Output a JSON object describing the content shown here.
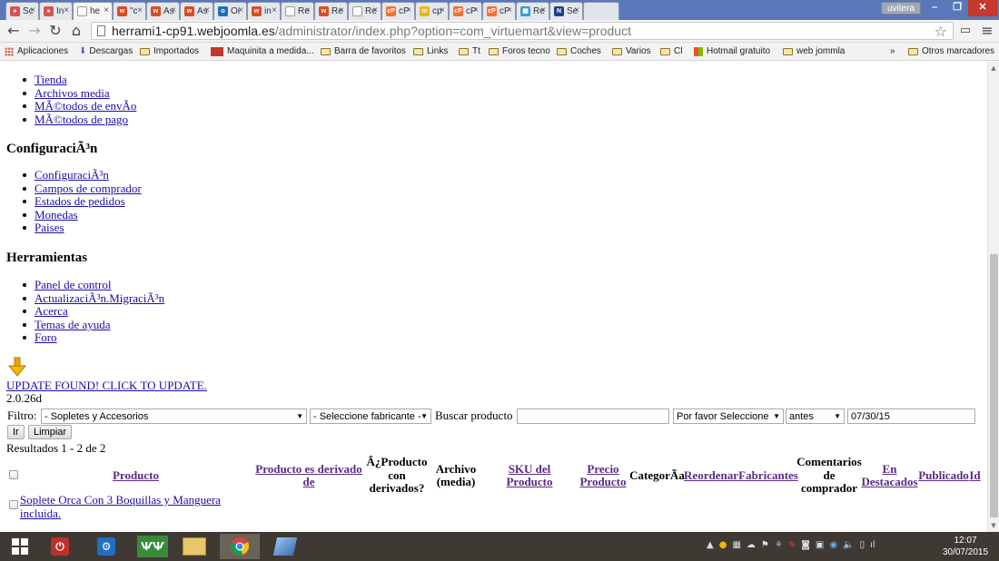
{
  "browser": {
    "tabs": [
      {
        "label": "Sc",
        "favicon_color": "#d9534f",
        "favicon_glyph": "●"
      },
      {
        "label": "In",
        "favicon_color": "#d9534f",
        "favicon_glyph": "●"
      },
      {
        "label": "he",
        "favicon_color": "#ffffff",
        "favicon_glyph": "",
        "active": true
      },
      {
        "label": "\"c",
        "favicon_color": "#e04a1f",
        "favicon_glyph": "w"
      },
      {
        "label": "As",
        "favicon_color": "#e04a1f",
        "favicon_glyph": "w"
      },
      {
        "label": "As",
        "favicon_color": "#e04a1f",
        "favicon_glyph": "w"
      },
      {
        "label": "Oi",
        "favicon_color": "#1e6fbf",
        "favicon_glyph": "o"
      },
      {
        "label": "in",
        "favicon_color": "#e04a1f",
        "favicon_glyph": "w"
      },
      {
        "label": "Re",
        "favicon_color": "#ffffff",
        "favicon_glyph": ""
      },
      {
        "label": "Re",
        "favicon_color": "#e04a1f",
        "favicon_glyph": "w"
      },
      {
        "label": "Re",
        "favicon_color": "#ffffff",
        "favicon_glyph": ""
      },
      {
        "label": "cP",
        "favicon_color": "#ff6c2c",
        "favicon_glyph": "cP"
      },
      {
        "label": "cp",
        "favicon_color": "#f0b400",
        "favicon_glyph": "m"
      },
      {
        "label": "cP",
        "favicon_color": "#ff6c2c",
        "favicon_glyph": "cP"
      },
      {
        "label": "cP",
        "favicon_color": "#ff6c2c",
        "favicon_glyph": "cP"
      },
      {
        "label": "Re",
        "favicon_color": "#3a9ad9",
        "favicon_glyph": "▦"
      },
      {
        "label": "Se",
        "favicon_color": "#1e3f8a",
        "favicon_glyph": "N"
      }
    ],
    "user_badge": "uvitera",
    "window_buttons": [
      "–",
      "❐",
      "✕"
    ],
    "url_host": "herrami1-cp91.webjoomla.es",
    "url_path": "/administrator/index.php?option=com_virtuemart&view=product",
    "bookmarks": [
      {
        "label": "Aplicaciones",
        "icon": "apps-grid-icon"
      },
      {
        "label": "Descargas",
        "icon": "download-icon"
      },
      {
        "label": "Importados",
        "icon": "folder-icon"
      },
      {
        "label": "Maquinita a medida...",
        "icon": "maquinita-icon"
      },
      {
        "label": "Barra de favoritos",
        "icon": "folder-icon"
      },
      {
        "label": "Links",
        "icon": "folder-icon"
      },
      {
        "label": "Tt",
        "icon": "folder-icon"
      },
      {
        "label": "Foros tecno",
        "icon": "folder-icon"
      },
      {
        "label": "Coches",
        "icon": "folder-icon"
      },
      {
        "label": "Varios",
        "icon": "folder-icon"
      },
      {
        "label": "Cl",
        "icon": "folder-icon"
      },
      {
        "label": "Hotmail gratuito",
        "icon": "hotmail-icon"
      },
      {
        "label": "web jommla",
        "icon": "folder-icon"
      }
    ],
    "bookmarks_overflow": "»",
    "other_bookmarks": "Otros marcadores"
  },
  "page": {
    "menu_top": [
      "Tienda",
      "Archivos media",
      "MÃ©todos de envÃo",
      "MÃ©todos de pago"
    ],
    "section_config": "ConfiguraciÃ³n",
    "menu_config": [
      "ConfiguraciÃ³n",
      "Campos de comprador",
      "Estados de pedidos",
      "Monedas",
      "Paises"
    ],
    "section_tools": "Herramientas",
    "menu_tools": [
      "Panel de control",
      "ActualizaciÃ³n.MigraciÃ³n",
      "Acerca",
      "Temas de ayuda",
      "Foro"
    ],
    "update_link": "UPDATE FOUND! CLICK TO UPDATE.",
    "version": "2.0.26d",
    "filter": {
      "label": "Filtro:",
      "category_value": "- Sopletes y Accesorios",
      "manufacturer_value": "- Seleccione fabricante -",
      "search_label": "Buscar producto",
      "search_value": "",
      "date_type_value": "Por favor Seleccione",
      "date_op_value": "antes",
      "date_value": "07/30/15",
      "go_label": "Ir",
      "clear_label": "Limpiar"
    },
    "results_text": "Resultados 1 - 2 de 2",
    "columns": [
      {
        "label": "Producto",
        "link": true
      },
      {
        "label": "Producto es derivado de",
        "link": true
      },
      {
        "label": "Â¿Producto con derivados?",
        "link": false
      },
      {
        "label": "Archivo (media)",
        "link": false
      },
      {
        "label": "SKU del Producto",
        "link": true
      },
      {
        "label": "Precio Producto",
        "link": true
      },
      {
        "label": "CategorÃ­a",
        "link": false
      },
      {
        "label": "Reordenar",
        "link": true
      },
      {
        "label": "Fabricantes",
        "link": true
      },
      {
        "label": "Comentarios de comprador",
        "link": false
      },
      {
        "label": "En Destacados",
        "link": true
      },
      {
        "label": "Publicado",
        "link": true
      },
      {
        "label": "Id",
        "link": true
      }
    ],
    "rows": [
      {
        "product": "Soplete Orca Con 3 Boquillas y Manguera incluida."
      }
    ]
  },
  "taskbar": {
    "items": [
      {
        "name": "start-icon"
      },
      {
        "name": "power-app-icon"
      },
      {
        "name": "settings-app-icon"
      },
      {
        "name": "photo-app-icon"
      },
      {
        "name": "file-explorer-icon"
      },
      {
        "name": "chrome-icon"
      },
      {
        "name": "notepad-app-icon"
      }
    ],
    "time": "12:07",
    "date": "30/07/2015"
  }
}
